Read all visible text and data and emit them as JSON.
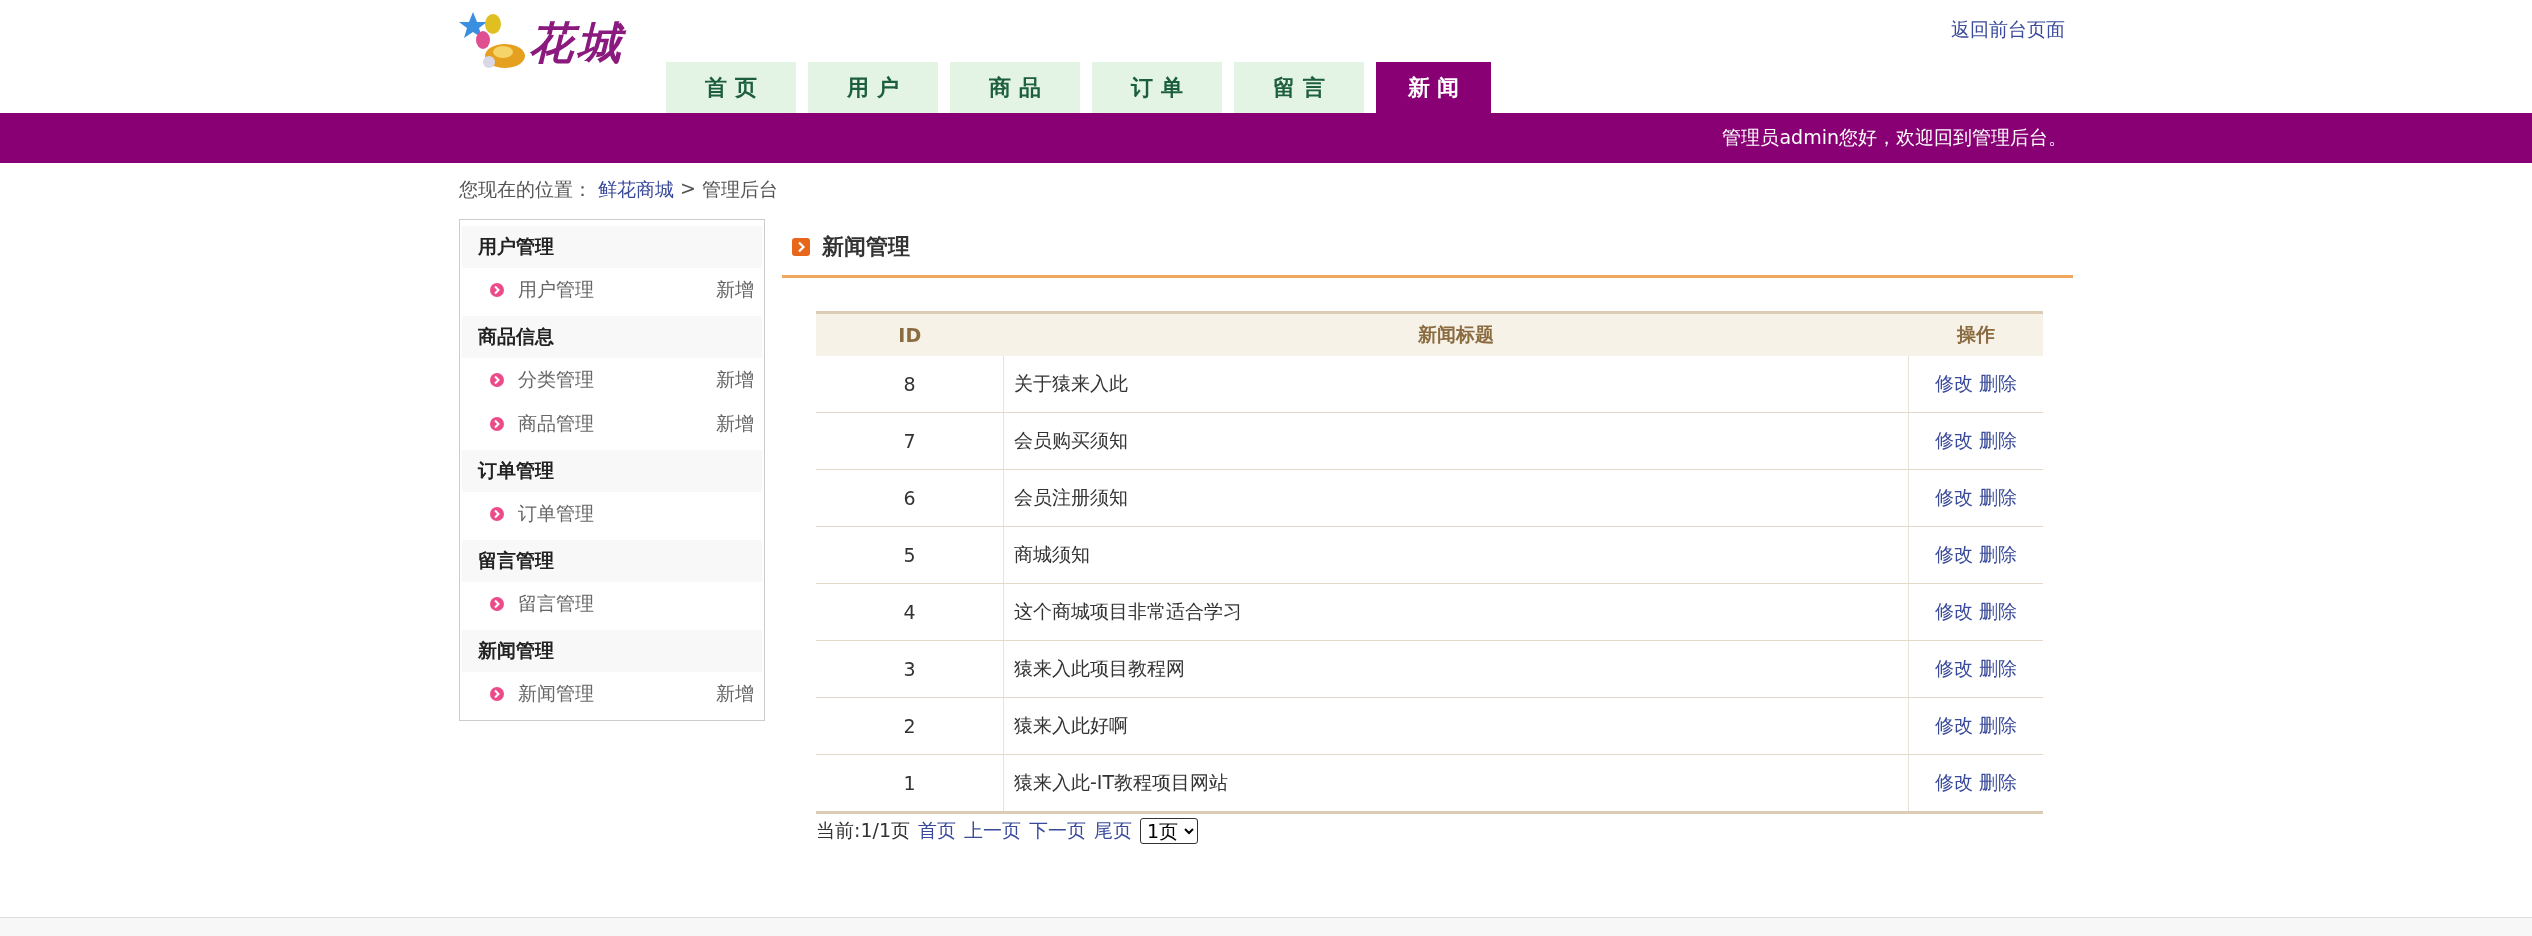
{
  "header": {
    "logo_text": "花城",
    "back_link": "返回前台页面"
  },
  "tabs": [
    {
      "label": "首 页",
      "selected": false
    },
    {
      "label": "用 户",
      "selected": false
    },
    {
      "label": "商 品",
      "selected": false
    },
    {
      "label": "订 单",
      "selected": false
    },
    {
      "label": "留 言",
      "selected": false
    },
    {
      "label": "新 闻",
      "selected": true
    }
  ],
  "welcome": "管理员admin您好，欢迎回到管理后台。",
  "breadcrumb": {
    "label": "您现在的位置：",
    "link": "鲜花商城",
    "separator": ">",
    "current": "管理后台"
  },
  "sidebar": {
    "groups": [
      {
        "title": "用户管理",
        "items": [
          {
            "label": "用户管理",
            "action": "新增"
          }
        ]
      },
      {
        "title": "商品信息",
        "items": [
          {
            "label": "分类管理",
            "action": "新增"
          },
          {
            "label": "商品管理",
            "action": "新增"
          }
        ]
      },
      {
        "title": "订单管理",
        "items": [
          {
            "label": "订单管理"
          }
        ]
      },
      {
        "title": "留言管理",
        "items": [
          {
            "label": "留言管理"
          }
        ]
      },
      {
        "title": "新闻管理",
        "items": [
          {
            "label": "新闻管理",
            "action": "新增"
          }
        ]
      }
    ]
  },
  "section_title": "新闻管理",
  "table": {
    "columns": [
      "ID",
      "新闻标题",
      "操作"
    ],
    "rows": [
      {
        "id": "8",
        "title": "关于猿来入此",
        "actions": [
          "修改",
          "删除"
        ]
      },
      {
        "id": "7",
        "title": "会员购买须知",
        "actions": [
          "修改",
          "删除"
        ]
      },
      {
        "id": "6",
        "title": "会员注册须知",
        "actions": [
          "修改",
          "删除"
        ]
      },
      {
        "id": "5",
        "title": "商城须知",
        "actions": [
          "修改",
          "删除"
        ]
      },
      {
        "id": "4",
        "title": "这个商城项目非常适合学习",
        "actions": [
          "修改",
          "删除"
        ]
      },
      {
        "id": "3",
        "title": "猿来入此项目教程网",
        "actions": [
          "修改",
          "删除"
        ]
      },
      {
        "id": "2",
        "title": "猿来入此好啊",
        "actions": [
          "修改",
          "删除"
        ]
      },
      {
        "id": "1",
        "title": "猿来入此-IT教程项目网站",
        "actions": [
          "修改",
          "删除"
        ]
      }
    ]
  },
  "pagination": {
    "status": "当前:1/1页",
    "links": [
      "首页",
      "上一页",
      "下一页",
      "尾页"
    ],
    "page_select": "1页"
  }
}
